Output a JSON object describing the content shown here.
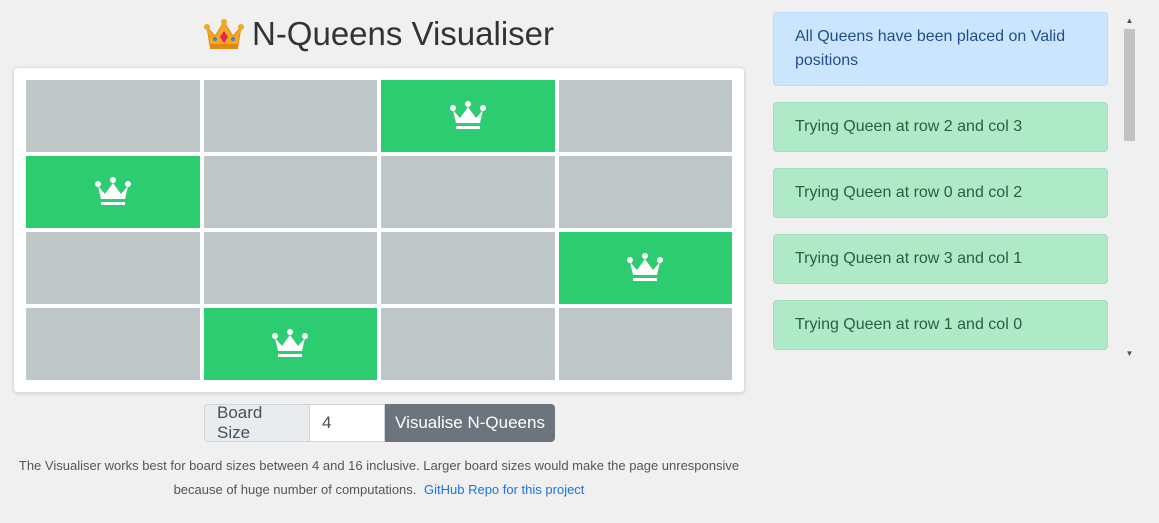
{
  "header": {
    "title": "N-Queens Visualiser",
    "icon": "crown-icon"
  },
  "board": {
    "size": 4,
    "queens": [
      {
        "row": 0,
        "col": 2
      },
      {
        "row": 1,
        "col": 0
      },
      {
        "row": 2,
        "col": 3
      },
      {
        "row": 3,
        "col": 1
      }
    ],
    "colors": {
      "empty": "#c0c7c8",
      "queen": "#2ecc71"
    }
  },
  "controls": {
    "label": "Board Size",
    "value": "4",
    "button": "Visualise N-Queens"
  },
  "note": {
    "text": "The Visualiser works best for board sizes between 4 and 16 inclusive. Larger board sizes would make the page unresponsive because of huge number of computations.",
    "link": "GitHub Repo for this project"
  },
  "log": {
    "status": "All Queens have been placed on Valid positions",
    "items": [
      "Trying Queen at row 2 and col 3",
      "Trying Queen at row 0 and col 2",
      "Trying Queen at row 3 and col 1",
      "Trying Queen at row 1 and col 0"
    ]
  }
}
